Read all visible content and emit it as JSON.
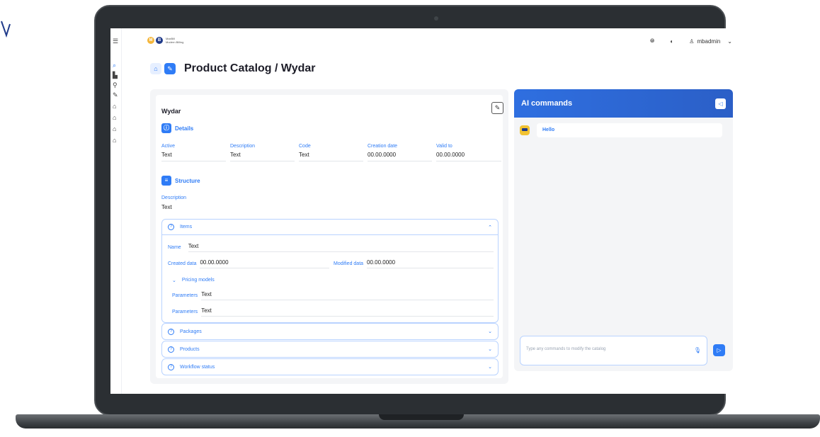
{
  "topbar": {
    "logo_m": "M",
    "logo_b": "B",
    "logo_text_1": "MaxBill",
    "logo_text_2": "Modern Billing",
    "user": "mbadmin"
  },
  "header": {
    "title": "Product Catalog / Wydar"
  },
  "card": {
    "name": "Wydar",
    "details_title": "Details",
    "fields": [
      {
        "label": "Active",
        "value": "Text"
      },
      {
        "label": "Description",
        "value": "Text"
      },
      {
        "label": "Code",
        "value": "Text"
      },
      {
        "label": "Creation date",
        "value": "00.00.0000"
      },
      {
        "label": "Valid to",
        "value": "00.00.0000"
      }
    ],
    "structure_title": "Structure",
    "structure_desc_label": "Description",
    "structure_desc_value": "Text",
    "items": {
      "title": "Items",
      "name_label": "Name",
      "name_value": "Text",
      "created_label": "Created data",
      "created_value": "00.00.0000",
      "modified_label": "Modified data",
      "modified_value": "00.00.0000",
      "pricing_title": "Pricing models",
      "params": [
        {
          "label": "Parameters",
          "value": "Text"
        },
        {
          "label": "Parameters",
          "value": "Text"
        }
      ]
    },
    "packages_title": "Packages",
    "products_title": "Products",
    "workflow_title": "Workflow status"
  },
  "ai": {
    "title": "AI commands",
    "message": "Hello",
    "input_placeholder": "Type any commands to modify the catalog"
  },
  "colors": {
    "accent": "#2f7cf6",
    "header_gradient_start": "#2f6fe0"
  }
}
